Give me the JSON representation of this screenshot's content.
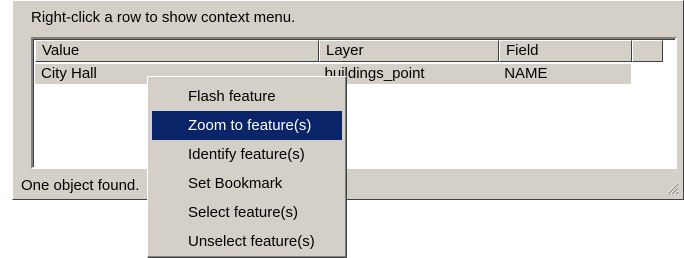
{
  "window": {
    "instruction": "Right-click a row to show context menu.",
    "status": "One object found."
  },
  "listview": {
    "columns": [
      {
        "label": "Value"
      },
      {
        "label": "Layer"
      },
      {
        "label": "Field"
      },
      {
        "label": ""
      }
    ],
    "rows": [
      {
        "value": "City Hall",
        "layer": "buildings_point",
        "field": "NAME"
      }
    ]
  },
  "context_menu": {
    "items": [
      {
        "label": "Flash feature"
      },
      {
        "label": "Zoom to feature(s)",
        "selected": true
      },
      {
        "label": "Identify feature(s)"
      },
      {
        "label": "Set Bookmark"
      },
      {
        "label": "Select feature(s)"
      },
      {
        "label": "Unselect feature(s)"
      }
    ]
  },
  "colors": {
    "face": "#d4d0c8",
    "highlight": "#0a246a",
    "highlight_text": "#ffffff"
  }
}
